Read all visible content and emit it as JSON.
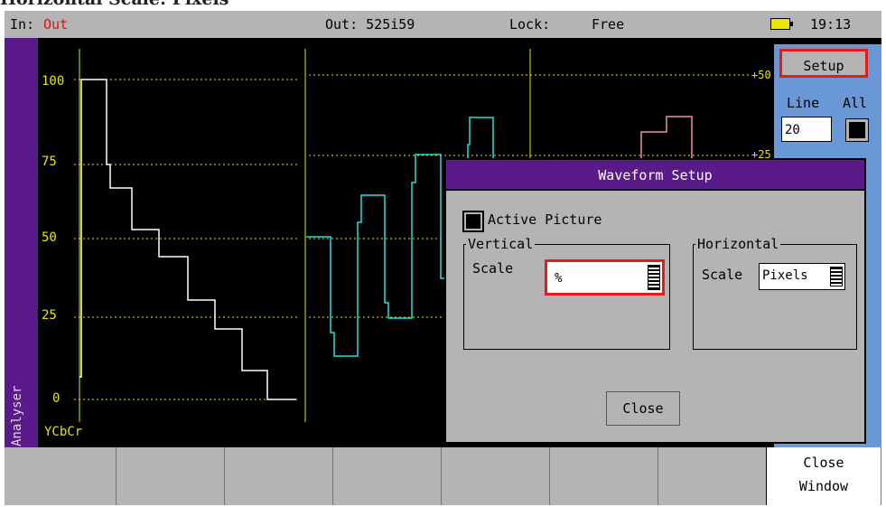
{
  "caption": "Horizontal Scale: Pixels",
  "status_bar": {
    "input_label": "In:",
    "input_value": "Out",
    "output": "Out: 525i59",
    "lock_label": "Lock:",
    "lock_value": "Free",
    "time": "19:13",
    "accent_color": "#e01010"
  },
  "sidebar": {
    "label": "Analyser"
  },
  "waveform": {
    "y_ticks": [
      "100",
      "75",
      "50",
      "25",
      "0"
    ],
    "right_ticks": [
      "+50",
      "+25"
    ],
    "colorspace": "YCbCr",
    "trace_colors": {
      "luma": "#ffffff",
      "cb": "#20e0e0",
      "cr": "#f08cb4",
      "grid": "#e6e600"
    }
  },
  "right_panel": {
    "setup_button": "Setup",
    "line_label": "Line",
    "all_label": "All",
    "line_value": "20"
  },
  "dialog": {
    "title": "Waveform Setup",
    "active_picture_label": "Active Picture",
    "vertical": {
      "title": "Vertical",
      "scale_label": "Scale",
      "scale_value": "%"
    },
    "horizontal": {
      "title": "Horizontal",
      "scale_label": "Scale",
      "scale_value": "Pixels"
    },
    "close_button": "Close"
  },
  "softkeys": {
    "close_window_line1": "Close",
    "close_window_line2": "Window"
  }
}
